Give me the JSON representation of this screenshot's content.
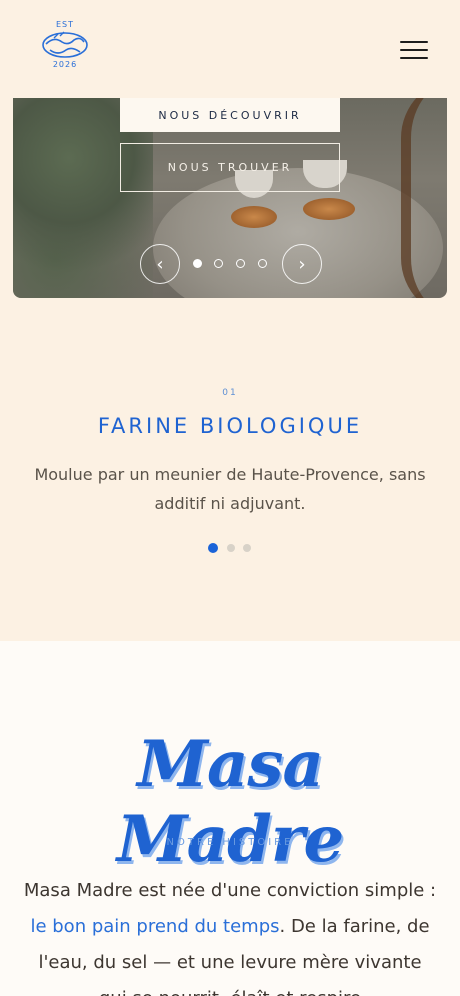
{
  "header": {
    "logo": {
      "top_text": "EST",
      "bottom_text": "2026"
    },
    "menu_icon": "hamburger-menu-icon"
  },
  "hero": {
    "primary_button": "NOUS DÉCOUVRIR",
    "secondary_button": "NOUS TROUVER",
    "prev_icon": "‹",
    "next_icon": "›",
    "slides_total": 4,
    "active_slide": 1
  },
  "feature": {
    "number": "01",
    "title": "FARINE BIOLOGIQUE",
    "description": "Moulue par un meunier de Haute-Provence, sans additif ni adjuvant.",
    "pages_total": 3,
    "active_page": 1
  },
  "story": {
    "script_title": "Masa Madre",
    "kicker": "NOTRE HISTOIRE",
    "paragraph_before": "Masa Madre est née d'une conviction simple : ",
    "paragraph_highlight": "le bon pain prend du temps",
    "paragraph_after": ". De la farine, de l'eau, du sel — et une levure mère vivante qui se nourrit, élaît et respire"
  },
  "colors": {
    "background": "#fcf1e3",
    "accent_blue": "#1f63d1",
    "story_background": "#fefbf7"
  }
}
